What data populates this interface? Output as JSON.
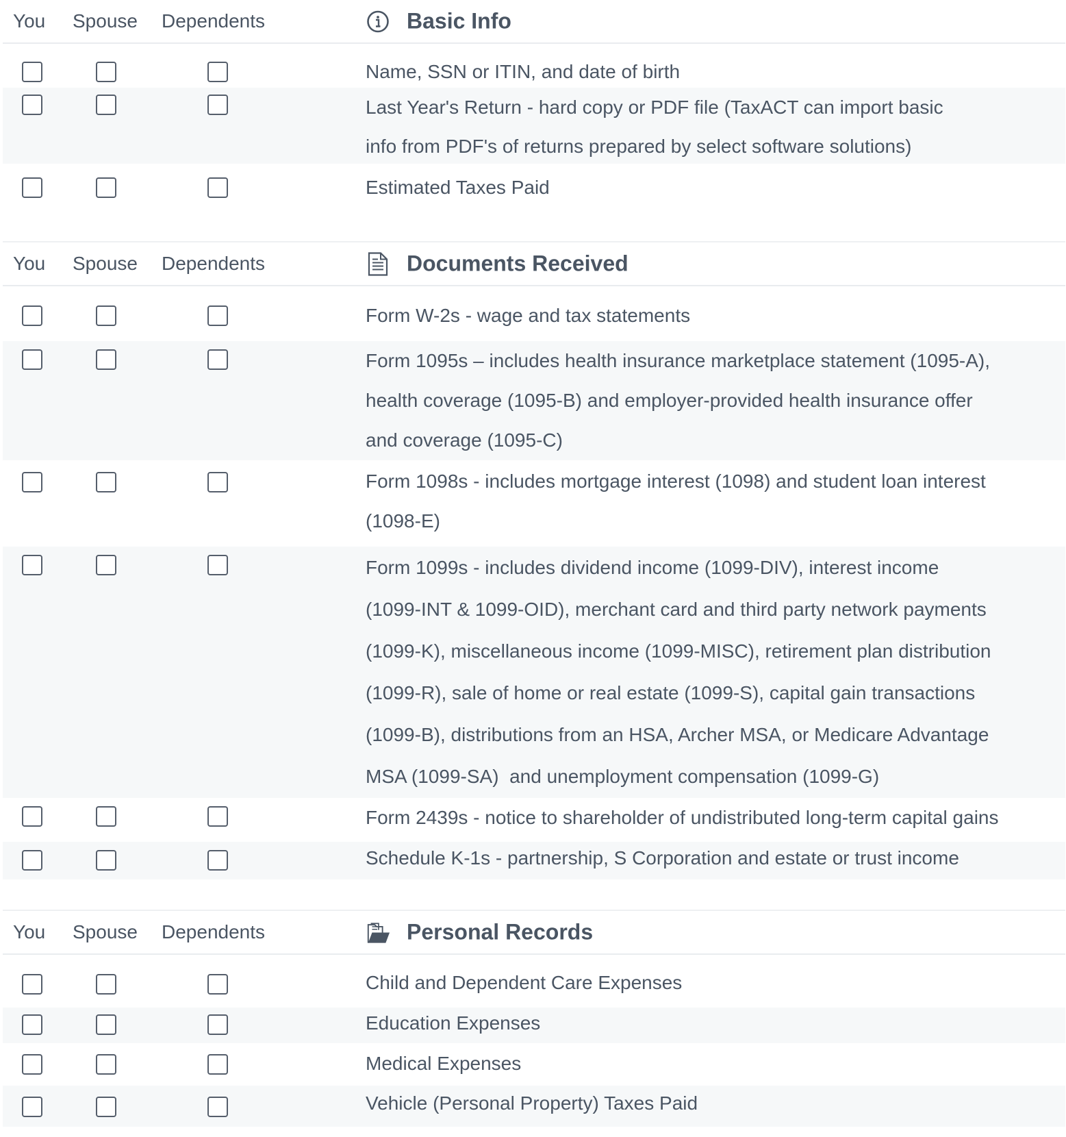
{
  "columns": {
    "you": "You",
    "spouse": "Spouse",
    "dependents": "Dependents"
  },
  "sections": [
    {
      "title": "Basic Info",
      "icon": "info-circle-icon",
      "items": [
        {
          "text": "Name, SSN or ITIN, and date of birth"
        },
        {
          "text": "Last Year's Return - hard copy or PDF file (TaxACT can import basic\ninfo from PDF's of returns prepared by select software solutions)"
        },
        {
          "text": "Estimated Taxes Paid"
        }
      ]
    },
    {
      "title": "Documents Received",
      "icon": "document-icon",
      "items": [
        {
          "text": "Form W-2s - wage and tax statements"
        },
        {
          "text": "Form 1095s – includes health insurance marketplace statement (1095-A),\nhealth coverage (1095-B) and employer-provided health insurance offer\nand coverage (1095-C)"
        },
        {
          "text": "Form 1098s - includes mortgage interest (1098) and student loan interest\n(1098-E)"
        },
        {
          "text": "Form 1099s - includes dividend income (1099-DIV), interest income\n(1099-INT & 1099-OID), merchant card and third party network payments\n(1099-K), miscellaneous income (1099-MISC), retirement plan distribution\n(1099-R), sale of home or real estate (1099-S), capital gain transactions\n(1099-B), distributions from an HSA, Archer MSA, or Medicare Advantage\nMSA (1099-SA)  and unemployment compensation (1099-G)"
        },
        {
          "text": "Form 2439s - notice to shareholder of undistributed long-term capital gains"
        },
        {
          "text": "Schedule K-1s - partnership, S Corporation and estate or trust income"
        }
      ]
    },
    {
      "title": "Personal Records",
      "icon": "open-folder-icon",
      "items": [
        {
          "text": "Child and Dependent Care Expenses"
        },
        {
          "text": "Education Expenses"
        },
        {
          "text": "Medical Expenses"
        },
        {
          "text": "Vehicle (Personal Property) Taxes Paid"
        }
      ]
    }
  ],
  "colors": {
    "text": "#4a5563",
    "row_alt": "#f6f8f9",
    "divider": "#e9ecef",
    "checkbox_border": "#555e6b"
  }
}
